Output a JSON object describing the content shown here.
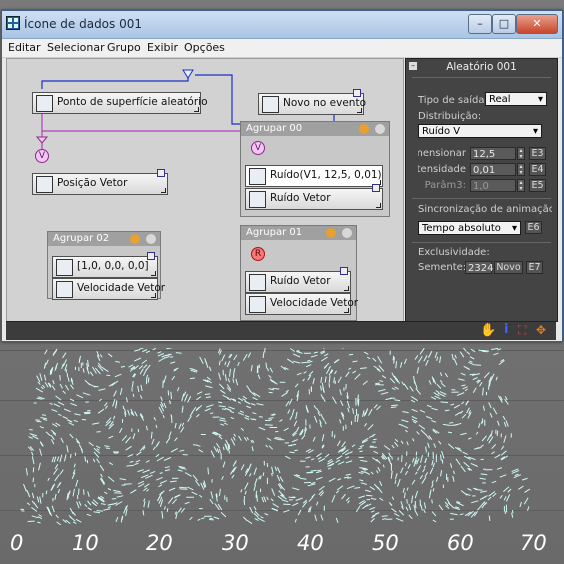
{
  "window": {
    "title": "Ícone de dados 001",
    "controls": {
      "minimize": "–",
      "maximize": "□",
      "close": "✕"
    }
  },
  "menu": [
    "Editar",
    "Selecionar",
    "Grupo",
    "Exibir",
    "Opções"
  ],
  "nodes": {
    "surface_point": "Ponto de superfície aleatório",
    "new_event": "Novo no evento",
    "position_vector": "Posição Vetor",
    "noise_expr": "Ruído(V1, 12,5, 0,01)",
    "noise_vector_g0": "Ruído  Vetor",
    "vector_const": "[1,0, 0,0, 0,0]",
    "velocity_vector_g2": "Velocidade Vetor",
    "noise_vector_g1": "Ruído  Vetor",
    "velocity_vector_g1": "Velocidade Vetor"
  },
  "groups": {
    "g0": "Agrupar 00",
    "g1": "Agrupar 01",
    "g2": "Agrupar 02"
  },
  "badges": {
    "v": "V",
    "r": "R"
  },
  "panel": {
    "title": "Aleatório 001",
    "output_type_label": "Tipo de saída:",
    "output_type_value": "Real",
    "distribution_label": "Distribuição:",
    "distribution_value": "Ruído V",
    "dimension_label": "Dimensionar:",
    "dimension_value": "12,5",
    "dimension_btn": "E3",
    "intensity_label": "Intensidade:",
    "intensity_value": "0,01",
    "intensity_btn": "E4",
    "param3_label": "Parâm3:",
    "param3_value": "1,0",
    "param3_btn": "E5",
    "sync_label": "Sincronização de animação d",
    "sync_value": "Tempo absoluto",
    "sync_btn": "E6",
    "uniqueness_label": "Exclusividade:",
    "seed_label": "Semente:",
    "seed_value": "2324",
    "new_btn": "Novo",
    "seed_btn": "E7"
  },
  "axis_labels": [
    "0",
    "10",
    "20",
    "30",
    "40",
    "50",
    "60",
    "70"
  ],
  "colors": {
    "particle": "#cffaf6",
    "wire_blue": "#1a2fc8",
    "wire_purple": "#b040c0",
    "panel_bg": "#444444"
  }
}
